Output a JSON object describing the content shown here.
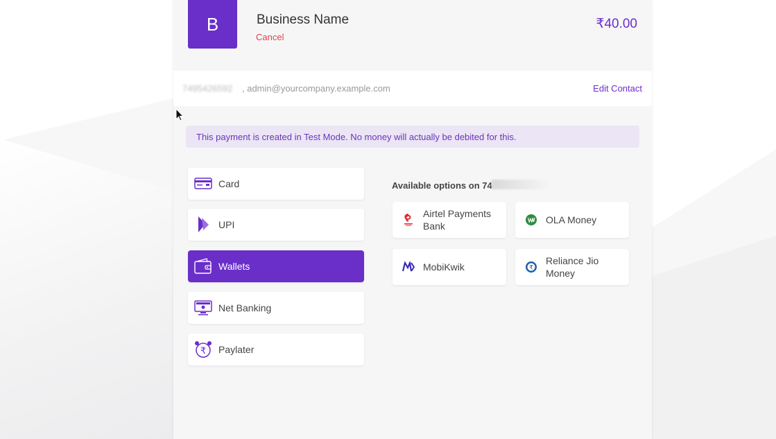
{
  "header": {
    "logo_letter": "B",
    "business_name": "Business Name",
    "cancel_label": "Cancel",
    "amount": "₹40.00"
  },
  "contact": {
    "phone": "7495426592",
    "email": ", admin@yourcompany.example.com",
    "edit_label": "Edit Contact"
  },
  "notice": "This payment is created in Test Mode. No money will actually be debited for this.",
  "methods": [
    {
      "label": "Card",
      "icon": "card-icon",
      "active": false
    },
    {
      "label": "UPI",
      "icon": "upi-icon",
      "active": false
    },
    {
      "label": "Wallets",
      "icon": "wallet-icon",
      "active": true
    },
    {
      "label": "Net Banking",
      "icon": "net-banking-icon",
      "active": false
    },
    {
      "label": "Paylater",
      "icon": "paylater-icon",
      "active": false
    }
  ],
  "available": {
    "label": "Available options on 74",
    "wallets": [
      {
        "label": "Airtel Payments Bank",
        "icon": "airtel-icon"
      },
      {
        "label": "OLA Money",
        "icon": "ola-money-icon"
      },
      {
        "label": "MobiKwik",
        "icon": "mobikwik-icon"
      },
      {
        "label": "Reliance Jio Money",
        "icon": "jio-money-icon"
      }
    ]
  },
  "colors": {
    "accent": "#6a2ec9",
    "cancel": "#e0424b",
    "notice_bg": "#ebe5f5"
  }
}
